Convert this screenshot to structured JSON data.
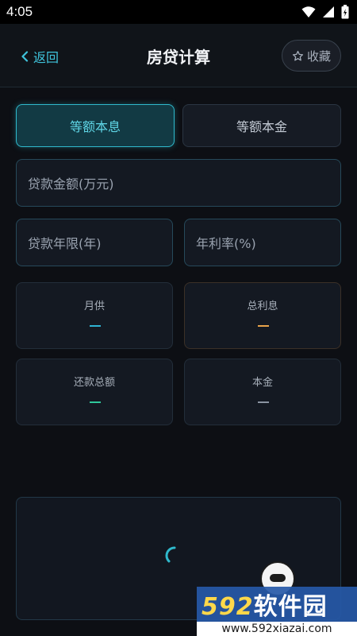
{
  "status_bar": {
    "time": "4:05",
    "icons": [
      "wifi-icon",
      "signal-icon",
      "battery-icon"
    ]
  },
  "header": {
    "back_label": "返回",
    "title": "房贷计算",
    "favorite_label": "收藏"
  },
  "tabs": [
    {
      "label": "等额本息",
      "active": true
    },
    {
      "label": "等额本金",
      "active": false
    }
  ],
  "inputs": {
    "amount": {
      "placeholder": "贷款金额(万元)",
      "value": ""
    },
    "years": {
      "placeholder": "贷款年限(年)",
      "value": ""
    },
    "rate": {
      "placeholder": "年利率(%)",
      "value": ""
    }
  },
  "results": {
    "monthly": {
      "label": "月供",
      "value": "—",
      "color": "#2fb3d3"
    },
    "interest": {
      "label": "总利息",
      "value": "—",
      "color": "#e8a34a"
    },
    "total": {
      "label": "还款总额",
      "value": "—",
      "color": "#2fc79a"
    },
    "principal": {
      "label": "本金",
      "value": "—",
      "color": "#8a93a1"
    }
  },
  "colors": {
    "accent": "#2fb9cc",
    "background": "#0d0f14"
  },
  "watermark": {
    "brand_num": "592",
    "brand_text": "软件园",
    "url": "www.592xiazai.com"
  }
}
